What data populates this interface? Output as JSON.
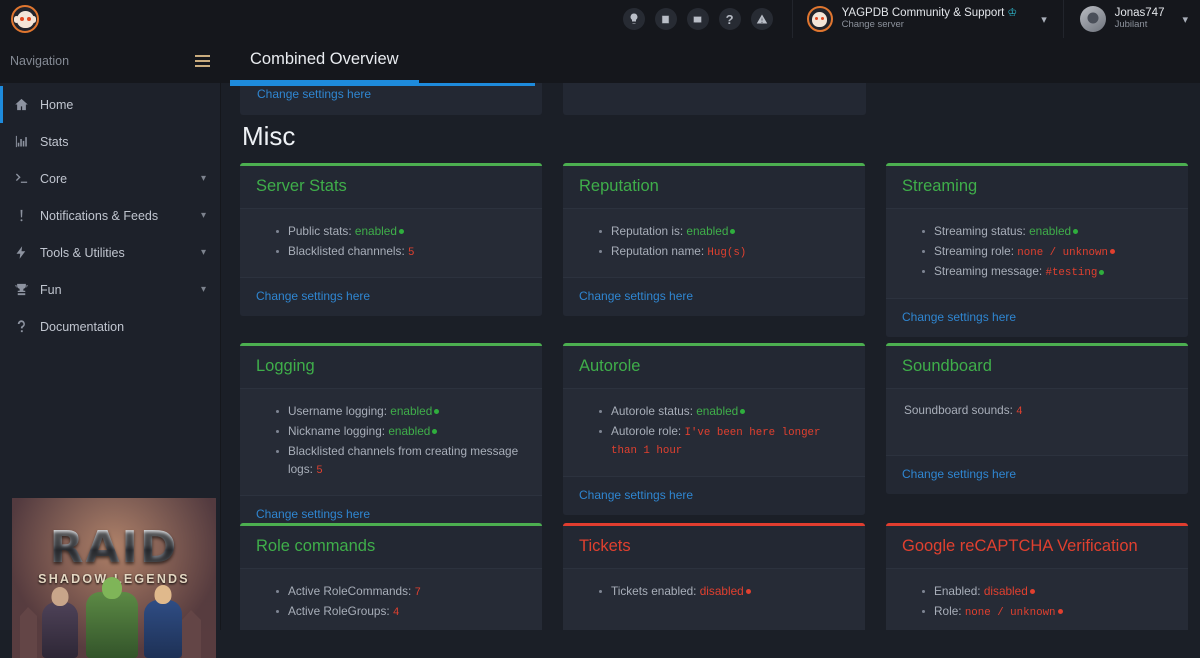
{
  "topbar": {
    "logo_icon": "yagpdb-logo-icon",
    "icons": [
      {
        "name": "lightbulb-icon",
        "glyph": "Ὂ1"
      },
      {
        "name": "book-icon",
        "glyph": "▤"
      },
      {
        "name": "news-icon",
        "glyph": "▦"
      },
      {
        "name": "help-icon",
        "glyph": "?"
      },
      {
        "name": "warning-icon",
        "glyph": "⚠"
      }
    ],
    "server": {
      "name": "YAGPDB Community & Support",
      "crown_icon": "crown-icon",
      "change_label": "Change server",
      "caret_icon": "chevron-down-icon"
    },
    "user": {
      "name": "Jonas747",
      "status": "Jubilant",
      "caret_icon": "chevron-down-icon"
    }
  },
  "subbar": {
    "nav_label": "Navigation",
    "burger_icon": "hamburger-menu-icon",
    "page_tab": "Combined Overview"
  },
  "sidebar": {
    "items": [
      {
        "label": "Home",
        "icon": "home-icon",
        "expandable": false,
        "active": true
      },
      {
        "label": "Stats",
        "icon": "chart-bar-icon",
        "expandable": false,
        "active": false
      },
      {
        "label": "Core",
        "icon": "terminal-icon",
        "expandable": true,
        "active": false
      },
      {
        "label": "Notifications & Feeds",
        "icon": "exclamation-icon",
        "expandable": true,
        "active": false
      },
      {
        "label": "Tools & Utilities",
        "icon": "bolt-icon",
        "expandable": true,
        "active": false
      },
      {
        "label": "Fun",
        "icon": "trophy-icon",
        "expandable": true,
        "active": false
      },
      {
        "label": "Documentation",
        "icon": "question-icon",
        "expandable": false,
        "active": false
      }
    ],
    "ad": {
      "title": "RAID",
      "subtitle": "SHADOW LEGENDS"
    }
  },
  "main": {
    "partial_card_link": "Change settings here",
    "section_title": "Misc",
    "change_settings_label": "Change settings here",
    "cards": [
      {
        "title": "Server Stats",
        "status": "ok",
        "items": [
          [
            {
              "t": "Public stats: ",
              "c": "muted"
            },
            {
              "t": "enabled",
              "c": "g"
            },
            {
              "t": "●",
              "c": "dot-g"
            }
          ],
          [
            {
              "t": "Blacklisted channnels: ",
              "c": "muted"
            },
            {
              "t": "5",
              "c": "r-mono"
            }
          ]
        ],
        "footer": "Change settings here"
      },
      {
        "title": "Reputation",
        "status": "ok",
        "items": [
          [
            {
              "t": "Reputation is: ",
              "c": "muted"
            },
            {
              "t": "enabled",
              "c": "g"
            },
            {
              "t": "●",
              "c": "dot-g"
            }
          ],
          [
            {
              "t": "Reputation name: ",
              "c": "muted"
            },
            {
              "t": "Hug(s)",
              "c": "r-mono"
            }
          ]
        ],
        "footer": "Change settings here"
      },
      {
        "title": "Streaming",
        "status": "ok",
        "items": [
          [
            {
              "t": "Streaming status: ",
              "c": "muted"
            },
            {
              "t": "enabled",
              "c": "g"
            },
            {
              "t": "●",
              "c": "dot-g"
            }
          ],
          [
            {
              "t": "Streaming role: ",
              "c": "muted"
            },
            {
              "t": "none  /  unknown",
              "c": "r-mono"
            },
            {
              "t": "●",
              "c": "dot-r"
            }
          ],
          [
            {
              "t": "Streaming message: ",
              "c": "muted"
            },
            {
              "t": "#testing",
              "c": "r-mono"
            },
            {
              "t": "●",
              "c": "dot-g"
            }
          ]
        ],
        "footer": "Change settings here"
      },
      {
        "title": "Logging",
        "status": "ok",
        "items": [
          [
            {
              "t": "Username logging: ",
              "c": "muted"
            },
            {
              "t": "enabled",
              "c": "g"
            },
            {
              "t": "●",
              "c": "dot-g"
            }
          ],
          [
            {
              "t": "Nickname logging: ",
              "c": "muted"
            },
            {
              "t": "enabled",
              "c": "g"
            },
            {
              "t": "●",
              "c": "dot-g"
            }
          ],
          [
            {
              "t": "Blacklisted channels from creating message logs: ",
              "c": "muted"
            },
            {
              "t": "5",
              "c": "r-mono"
            }
          ]
        ],
        "footer": "Change settings here"
      },
      {
        "title": "Autorole",
        "status": "ok",
        "items": [
          [
            {
              "t": "Autorole status: ",
              "c": "muted"
            },
            {
              "t": "enabled",
              "c": "g"
            },
            {
              "t": "●",
              "c": "dot-g"
            }
          ],
          [
            {
              "t": "Autorole role: ",
              "c": "muted"
            },
            {
              "t": "I've been here longer than 1 hour",
              "c": "r-mono"
            }
          ]
        ],
        "footer": "Change settings here"
      },
      {
        "title": "Soundboard",
        "status": "ok",
        "items": [
          [
            {
              "t": "Soundboard sounds: ",
              "c": "muted-plain"
            },
            {
              "t": "4",
              "c": "r-mono"
            }
          ]
        ],
        "footer": "Change settings here"
      },
      {
        "title": "Role commands",
        "status": "ok",
        "items": [
          [
            {
              "t": "Active RoleCommands: ",
              "c": "muted"
            },
            {
              "t": "7",
              "c": "r-mono"
            }
          ],
          [
            {
              "t": "Active RoleGroups: ",
              "c": "muted"
            },
            {
              "t": "4",
              "c": "r-mono"
            }
          ]
        ],
        "footer": ""
      },
      {
        "title": "Tickets",
        "status": "bad",
        "items": [
          [
            {
              "t": "Tickets enabled: ",
              "c": "muted"
            },
            {
              "t": "disabled",
              "c": "r"
            },
            {
              "t": "●",
              "c": "dot-r"
            }
          ]
        ],
        "footer": ""
      },
      {
        "title": "Google reCAPTCHA Verification",
        "status": "bad",
        "items": [
          [
            {
              "t": "Enabled: ",
              "c": "muted"
            },
            {
              "t": "disabled",
              "c": "r"
            },
            {
              "t": "●",
              "c": "dot-r"
            }
          ],
          [
            {
              "t": "Role: ",
              "c": "muted"
            },
            {
              "t": "none  /  unknown",
              "c": "r-mono"
            },
            {
              "t": "●",
              "c": "dot-r"
            }
          ]
        ],
        "footer": ""
      }
    ]
  },
  "colors": {
    "accent_blue": "#1e8bdc",
    "ok_green": "#4caf50",
    "bad_red": "#e03d2f",
    "link_blue": "#2f86d1",
    "page_bg": "#1b1f27",
    "card_bg": "#232833"
  }
}
